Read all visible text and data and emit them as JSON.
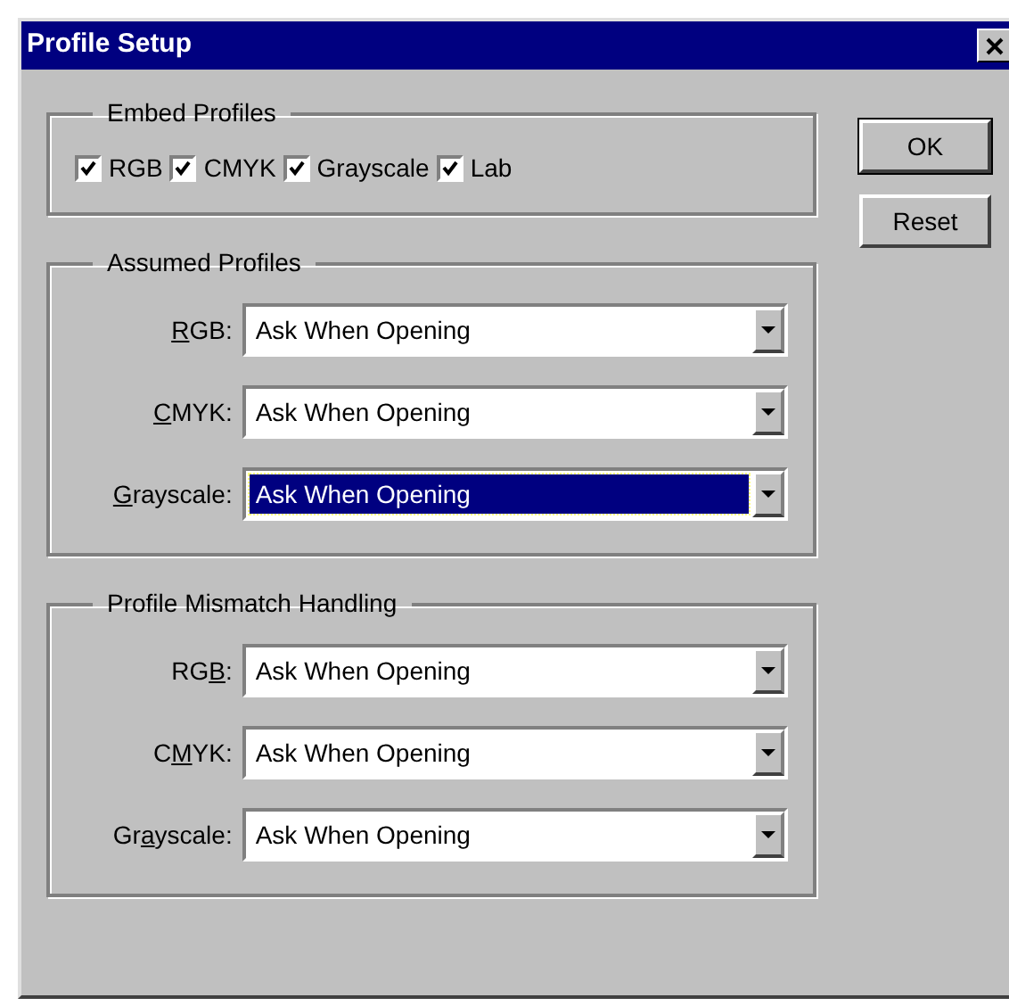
{
  "window": {
    "title": "Profile Setup"
  },
  "groups": [
    {
      "kind": "checkboxes",
      "title": "Embed Profiles",
      "items": [
        {
          "label": "RGB",
          "checked": true
        },
        {
          "label": "CMYK",
          "checked": true
        },
        {
          "label": "Grayscale",
          "checked": true
        },
        {
          "label": "Lab",
          "checked": true
        }
      ]
    },
    {
      "kind": "dropdowns",
      "title": "Assumed Profiles",
      "items": [
        {
          "access_key": "R",
          "label_after": "GB:",
          "value": "Ask When Opening",
          "selected": false
        },
        {
          "access_key": "C",
          "label_after": "MYK:",
          "value": "Ask When Opening",
          "selected": false
        },
        {
          "access_key": "G",
          "label_after": "rayscale:",
          "value": "Ask When Opening",
          "selected": true
        }
      ]
    },
    {
      "kind": "dropdowns",
      "title": "Profile Mismatch Handling",
      "items": [
        {
          "label_before": "RG",
          "access_key": "B",
          "label_after": ":",
          "value": "Ask When Opening",
          "selected": false
        },
        {
          "label_before": "C",
          "access_key": "M",
          "label_after": "YK:",
          "value": "Ask When Opening",
          "selected": false
        },
        {
          "label_before": "Gr",
          "access_key": "a",
          "label_after": "yscale:",
          "value": "Ask When Opening",
          "selected": false
        }
      ]
    }
  ],
  "buttons": [
    {
      "label": "OK",
      "default": true
    },
    {
      "label": "Reset",
      "default": false
    }
  ]
}
